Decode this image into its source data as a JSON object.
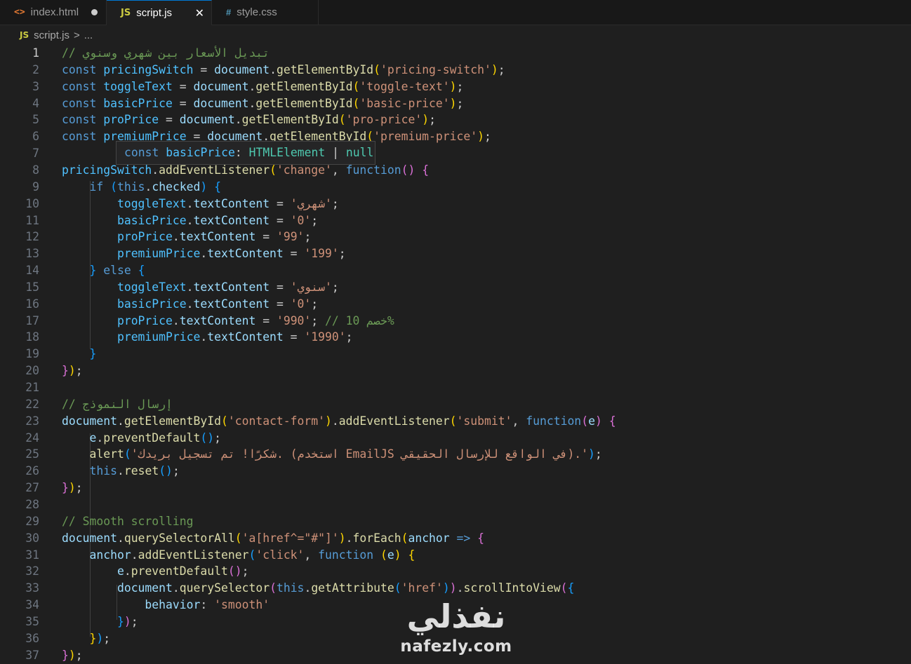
{
  "tabs": [
    {
      "icon": "<>",
      "label": "index.html",
      "modified": true
    },
    {
      "icon": "JS",
      "label": "script.js",
      "close": "✕"
    },
    {
      "icon": "#",
      "label": "style.css"
    }
  ],
  "breadcrumb": {
    "icon": "JS",
    "file": "script.js",
    "separator": ">",
    "tail": "..."
  },
  "line_numbers": [
    "1",
    "2",
    "3",
    "4",
    "5",
    "6",
    "7",
    "8",
    "9",
    "10",
    "11",
    "12",
    "13",
    "14",
    "15",
    "16",
    "17",
    "18",
    "19",
    "20",
    "21",
    "22",
    "23",
    "24",
    "25",
    "26",
    "27",
    "28",
    "29",
    "30",
    "31",
    "32",
    "33",
    "34",
    "35",
    "36",
    "37"
  ],
  "code_lines": [
    [
      [
        "c",
        "// تبديل الأسعار بين شهري وسنوي"
      ]
    ],
    [
      [
        "kw",
        "const "
      ],
      [
        "cn",
        "pricingSwitch"
      ],
      [
        "p",
        " = "
      ],
      [
        "v",
        "document"
      ],
      [
        "p",
        "."
      ],
      [
        "fn",
        "getElementById"
      ],
      [
        "b1",
        "("
      ],
      [
        "s",
        "'pricing-switch'"
      ],
      [
        "b1",
        ")"
      ],
      [
        "p",
        ";"
      ]
    ],
    [
      [
        "kw",
        "const "
      ],
      [
        "cn",
        "toggleText"
      ],
      [
        "p",
        " = "
      ],
      [
        "v",
        "document"
      ],
      [
        "p",
        "."
      ],
      [
        "fn",
        "getElementById"
      ],
      [
        "b1",
        "("
      ],
      [
        "s",
        "'toggle-text'"
      ],
      [
        "b1",
        ")"
      ],
      [
        "p",
        ";"
      ]
    ],
    [
      [
        "kw",
        "const "
      ],
      [
        "cn",
        "basicPrice"
      ],
      [
        "p",
        " = "
      ],
      [
        "v",
        "document"
      ],
      [
        "p",
        "."
      ],
      [
        "fn",
        "getElementById"
      ],
      [
        "b1",
        "("
      ],
      [
        "s",
        "'basic-price'"
      ],
      [
        "b1",
        ")"
      ],
      [
        "p",
        ";"
      ]
    ],
    [
      [
        "kw",
        "const "
      ],
      [
        "cn",
        "proPrice"
      ],
      [
        "p",
        " = "
      ],
      [
        "v",
        "document"
      ],
      [
        "p",
        "."
      ],
      [
        "fn",
        "getElementById"
      ],
      [
        "b1",
        "("
      ],
      [
        "s",
        "'pro-price'"
      ],
      [
        "b1",
        ")"
      ],
      [
        "p",
        ";"
      ]
    ],
    [
      [
        "kw",
        "const "
      ],
      [
        "cn",
        "premiumPrice"
      ],
      [
        "p",
        " = "
      ],
      [
        "v",
        "document"
      ],
      [
        "p",
        "."
      ],
      [
        "fn",
        "getElementById"
      ],
      [
        "b1",
        "("
      ],
      [
        "s",
        "'premium-price'"
      ],
      [
        "b1",
        ")"
      ],
      [
        "p",
        ";"
      ]
    ],
    [],
    [
      [
        "cn",
        "pricingSwitch"
      ],
      [
        "p",
        "."
      ],
      [
        "fn",
        "addEventListener"
      ],
      [
        "b1",
        "("
      ],
      [
        "s",
        "'change'"
      ],
      [
        "p",
        ", "
      ],
      [
        "kw",
        "function"
      ],
      [
        "b2",
        "()"
      ],
      [
        "p",
        " "
      ],
      [
        "b2",
        "{"
      ]
    ],
    [
      [
        "p",
        "    "
      ],
      [
        "kw",
        "if"
      ],
      [
        "p",
        " "
      ],
      [
        "b3",
        "("
      ],
      [
        "kw",
        "this"
      ],
      [
        "p",
        "."
      ],
      [
        "v",
        "checked"
      ],
      [
        "b3",
        ")"
      ],
      [
        "p",
        " "
      ],
      [
        "b3",
        "{"
      ]
    ],
    [
      [
        "p",
        "        "
      ],
      [
        "cn",
        "toggleText"
      ],
      [
        "p",
        "."
      ],
      [
        "v",
        "textContent"
      ],
      [
        "p",
        " = "
      ],
      [
        "s",
        "'شهري'"
      ],
      [
        "p",
        ";"
      ]
    ],
    [
      [
        "p",
        "        "
      ],
      [
        "cn",
        "basicPrice"
      ],
      [
        "p",
        "."
      ],
      [
        "v",
        "textContent"
      ],
      [
        "p",
        " = "
      ],
      [
        "s",
        "'0'"
      ],
      [
        "p",
        ";"
      ]
    ],
    [
      [
        "p",
        "        "
      ],
      [
        "cn",
        "proPrice"
      ],
      [
        "p",
        "."
      ],
      [
        "v",
        "textContent"
      ],
      [
        "p",
        " = "
      ],
      [
        "s",
        "'99'"
      ],
      [
        "p",
        ";"
      ]
    ],
    [
      [
        "p",
        "        "
      ],
      [
        "cn",
        "premiumPrice"
      ],
      [
        "p",
        "."
      ],
      [
        "v",
        "textContent"
      ],
      [
        "p",
        " = "
      ],
      [
        "s",
        "'199'"
      ],
      [
        "p",
        ";"
      ]
    ],
    [
      [
        "p",
        "    "
      ],
      [
        "b3",
        "}"
      ],
      [
        "p",
        " "
      ],
      [
        "kw",
        "else"
      ],
      [
        "p",
        " "
      ],
      [
        "b3",
        "{"
      ]
    ],
    [
      [
        "p",
        "        "
      ],
      [
        "cn",
        "toggleText"
      ],
      [
        "p",
        "."
      ],
      [
        "v",
        "textContent"
      ],
      [
        "p",
        " = "
      ],
      [
        "s",
        "'سنوي'"
      ],
      [
        "p",
        ";"
      ]
    ],
    [
      [
        "p",
        "        "
      ],
      [
        "cn",
        "basicPrice"
      ],
      [
        "p",
        "."
      ],
      [
        "v",
        "textContent"
      ],
      [
        "p",
        " = "
      ],
      [
        "s",
        "'0'"
      ],
      [
        "p",
        ";"
      ]
    ],
    [
      [
        "p",
        "        "
      ],
      [
        "cn",
        "proPrice"
      ],
      [
        "p",
        "."
      ],
      [
        "v",
        "textContent"
      ],
      [
        "p",
        " = "
      ],
      [
        "s",
        "'990'"
      ],
      [
        "p",
        "; "
      ],
      [
        "c",
        "// 10 خصم%"
      ]
    ],
    [
      [
        "p",
        "        "
      ],
      [
        "cn",
        "premiumPrice"
      ],
      [
        "p",
        "."
      ],
      [
        "v",
        "textContent"
      ],
      [
        "p",
        " = "
      ],
      [
        "s",
        "'1990'"
      ],
      [
        "p",
        ";"
      ]
    ],
    [
      [
        "p",
        "    "
      ],
      [
        "b3",
        "}"
      ]
    ],
    [
      [
        "b2",
        "}"
      ],
      [
        "b1",
        ")"
      ],
      [
        "p",
        ";"
      ]
    ],
    [],
    [
      [
        "c",
        "// إرسال النموذج"
      ]
    ],
    [
      [
        "v",
        "document"
      ],
      [
        "p",
        "."
      ],
      [
        "fn",
        "getElementById"
      ],
      [
        "b1",
        "("
      ],
      [
        "s",
        "'contact-form'"
      ],
      [
        "b1",
        ")"
      ],
      [
        "p",
        "."
      ],
      [
        "fn",
        "addEventListener"
      ],
      [
        "b1",
        "("
      ],
      [
        "s",
        "'submit'"
      ],
      [
        "p",
        ", "
      ],
      [
        "kw",
        "function"
      ],
      [
        "b2",
        "("
      ],
      [
        "v",
        "e"
      ],
      [
        "b2",
        ")"
      ],
      [
        "p",
        " "
      ],
      [
        "b2",
        "{"
      ]
    ],
    [
      [
        "p",
        "    "
      ],
      [
        "v",
        "e"
      ],
      [
        "p",
        "."
      ],
      [
        "fn",
        "preventDefault"
      ],
      [
        "b3",
        "()"
      ],
      [
        "p",
        ";"
      ]
    ],
    [
      [
        "p",
        "    "
      ],
      [
        "fn",
        "alert"
      ],
      [
        "b3",
        "("
      ],
      [
        "s",
        "'شكرًا! تم تسجيل بريدك. (استخدم EmailJS في الواقع للإرسال الحقيقي).'"
      ],
      [
        "b3",
        ")"
      ],
      [
        "p",
        ";"
      ]
    ],
    [
      [
        "p",
        "    "
      ],
      [
        "kw",
        "this"
      ],
      [
        "p",
        "."
      ],
      [
        "fn",
        "reset"
      ],
      [
        "b3",
        "()"
      ],
      [
        "p",
        ";"
      ]
    ],
    [
      [
        "b2",
        "}"
      ],
      [
        "b1",
        ")"
      ],
      [
        "p",
        ";"
      ]
    ],
    [],
    [
      [
        "c",
        "// Smooth scrolling"
      ]
    ],
    [
      [
        "v",
        "document"
      ],
      [
        "p",
        "."
      ],
      [
        "fn",
        "querySelectorAll"
      ],
      [
        "b1",
        "("
      ],
      [
        "s",
        "'a[href^=\"#\"]'"
      ],
      [
        "b1",
        ")"
      ],
      [
        "p",
        "."
      ],
      [
        "fn",
        "forEach"
      ],
      [
        "b1",
        "("
      ],
      [
        "v",
        "anchor"
      ],
      [
        "p",
        " "
      ],
      [
        "kw",
        "=>"
      ],
      [
        "p",
        " "
      ],
      [
        "b2",
        "{"
      ]
    ],
    [
      [
        "p",
        "    "
      ],
      [
        "v",
        "anchor"
      ],
      [
        "p",
        "."
      ],
      [
        "fn",
        "addEventListener"
      ],
      [
        "b3",
        "("
      ],
      [
        "s",
        "'click'"
      ],
      [
        "p",
        ", "
      ],
      [
        "kw",
        "function"
      ],
      [
        "p",
        " "
      ],
      [
        "b1",
        "("
      ],
      [
        "v",
        "e"
      ],
      [
        "b1",
        ")"
      ],
      [
        "p",
        " "
      ],
      [
        "b1",
        "{"
      ]
    ],
    [
      [
        "p",
        "        "
      ],
      [
        "v",
        "e"
      ],
      [
        "p",
        "."
      ],
      [
        "fn",
        "preventDefault"
      ],
      [
        "b2",
        "()"
      ],
      [
        "p",
        ";"
      ]
    ],
    [
      [
        "p",
        "        "
      ],
      [
        "v",
        "document"
      ],
      [
        "p",
        "."
      ],
      [
        "fn",
        "querySelector"
      ],
      [
        "b2",
        "("
      ],
      [
        "kw",
        "this"
      ],
      [
        "p",
        "."
      ],
      [
        "fn",
        "getAttribute"
      ],
      [
        "b3",
        "("
      ],
      [
        "s",
        "'href'"
      ],
      [
        "b3",
        ")"
      ],
      [
        "b2",
        ")"
      ],
      [
        "p",
        "."
      ],
      [
        "fn",
        "scrollIntoView"
      ],
      [
        "b2",
        "("
      ],
      [
        "b3",
        "{"
      ]
    ],
    [
      [
        "p",
        "            "
      ],
      [
        "v",
        "behavior"
      ],
      [
        "p",
        ": "
      ],
      [
        "s",
        "'smooth'"
      ]
    ],
    [
      [
        "p",
        "        "
      ],
      [
        "b3",
        "}"
      ],
      [
        "b2",
        ")"
      ],
      [
        "p",
        ";"
      ]
    ],
    [
      [
        "p",
        "    "
      ],
      [
        "b1",
        "}"
      ],
      [
        "b3",
        ")"
      ],
      [
        "p",
        ";"
      ]
    ],
    [
      [
        "b2",
        "}"
      ],
      [
        "b1",
        ")"
      ],
      [
        "p",
        ";"
      ]
    ]
  ],
  "hover": {
    "keyword": "const",
    "name": "basicPrice",
    "colon": ":",
    "type": "HTMLElement",
    "pipe": "|",
    "null_type": "null"
  },
  "watermark": {
    "arabic": "نفذلي",
    "latin": "nafezly.com"
  },
  "colors": {
    "background": "#1f1f1f",
    "keyword": "#569cd6",
    "string": "#ce9178",
    "comment": "#6a9955",
    "function": "#dcdcaa"
  }
}
